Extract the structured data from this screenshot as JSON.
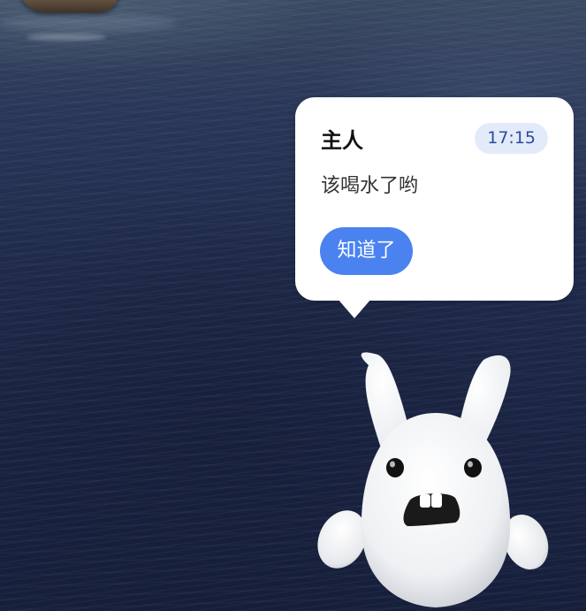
{
  "notification": {
    "sender": "主人",
    "time": "17:15",
    "message": "该喝水了哟",
    "ack_label": "知道了"
  },
  "mascot": {
    "icon": "bunny-mascot-icon"
  },
  "colors": {
    "bubble_background": "#ffffff",
    "button_background": "#4a82f0",
    "time_badge_background": "#e3ebfb",
    "time_badge_text": "#2d4b9a"
  }
}
